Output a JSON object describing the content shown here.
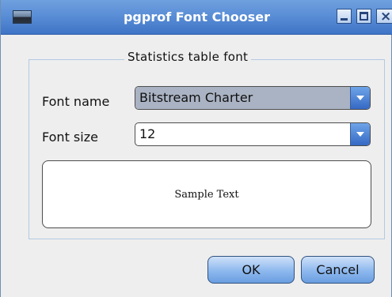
{
  "window": {
    "title": "pgprof Font Chooser",
    "icon": "app-window-icon",
    "controls": [
      "minimize-icon",
      "maximize-icon",
      "close-icon"
    ],
    "minimize_glyph": "_",
    "maximize_glyph": "□",
    "close_glyph": "×"
  },
  "group": {
    "legend": "Statistics table font"
  },
  "font_name": {
    "label": "Font name",
    "value": "Bitstream Charter"
  },
  "font_size": {
    "label": "Font size",
    "value": "12"
  },
  "sample": {
    "text": "Sample Text"
  },
  "buttons": {
    "ok": "OK",
    "cancel": "Cancel"
  },
  "colors": {
    "titlebar": "#4f86d3",
    "accent": "#3569c4",
    "dialog_bg": "#eeeeee"
  }
}
